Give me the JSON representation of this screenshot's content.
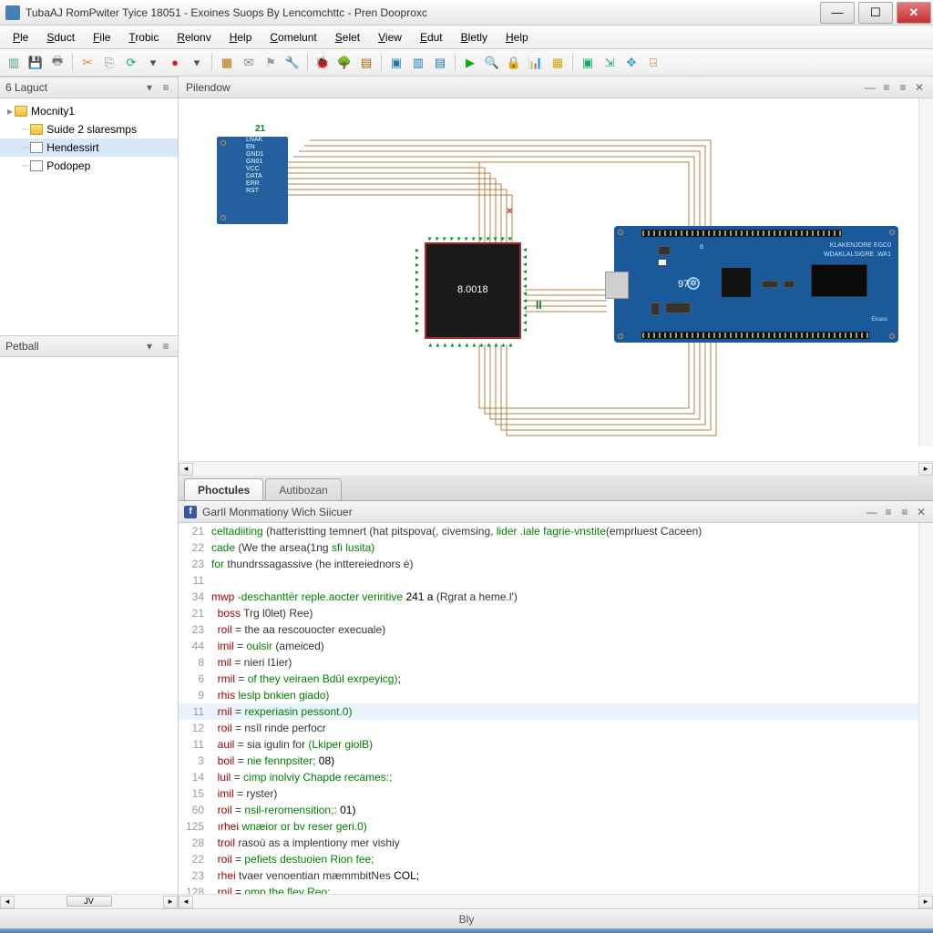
{
  "titlebar": {
    "text": "TubaAJ RomPwiter Tyice 18051 - Exoines Suops By Lencomchttc - Pren Dooproxc"
  },
  "menubar": [
    "Ple",
    "Sduct",
    "File",
    "Trobic",
    "Relonv",
    "Help",
    "Comelunt",
    "Selet",
    "View",
    "Edut",
    "Bletly",
    "Help"
  ],
  "left": {
    "layout_title": "6 Laguct",
    "tree": {
      "root": "Mocnity1",
      "children": [
        "Suide 2 slaresmps",
        "Hendessirt",
        "Podopep"
      ]
    },
    "lower_title": "Petball",
    "bottom_tab": "JV"
  },
  "canvas": {
    "title": "Pilendow",
    "net_label": "21",
    "chip_label": "8.0018",
    "pause_label": "II",
    "arduino_num": "97",
    "arduino_title1": "KLAKENJORE EGC0",
    "arduino_title2": "WDAKLALSIGRE .WA1",
    "module_pins": [
      "LNAK",
      "EN",
      "GND1",
      "GN01",
      "VCC",
      "DATA",
      "ERR",
      "RST"
    ]
  },
  "bottom_tabs": {
    "active": "Phoctules",
    "inactive": "Autibozan"
  },
  "code": {
    "title": "GarIl Monmationy Wich Siicuer",
    "status": "Bly",
    "lines": [
      {
        "n": "21",
        "html": "<span class='kw-green'>celtadiiting</span> <span class='kw-dark'>(hatteristting temnert (hat pitspova(, civemsing,</span> <span class='kw-green'>lider .iale fagrie-vnstite</span><span class='kw-dark'>(emprluest Caceen)</span>"
      },
      {
        "n": "22",
        "html": "<span class='kw-green'>cade</span> <span class='kw-dark'>(We the arsea(1ng</span> <span class='kw-green'>sfi lusita)</span>"
      },
      {
        "n": "23",
        "html": "<span class='kw-green'>for</span> <span class='kw-dark'>thundrssagassive (he inttereiednors é)</span>"
      },
      {
        "n": "11",
        "html": ""
      },
      {
        "n": "34",
        "html": "<span class='kw-red'>mwp</span> <span class='kw-green'>-deschanttër reple.aocter veriritive</span> <span class='kw-black'>241 a</span> <span class='kw-dark'>(Rgrat a heme.l')</span>"
      },
      {
        "n": "21",
        "html": "  <span class='kw-red'>boss</span> <span class='kw-dark'>Trg l0let) Ree)</span>"
      },
      {
        "n": "23",
        "html": "  <span class='kw-red'>roil</span> <span class='kw-dark'>= the aa rescouocter execuale)</span>"
      },
      {
        "n": "44",
        "html": "  <span class='kw-red'>imil</span> <span class='kw-dark'>=</span> <span class='kw-green'>oulsir</span> <span class='kw-dark'>(ameiced)</span>"
      },
      {
        "n": "8",
        "html": "  <span class='kw-red'>mil</span> <span class='kw-dark'>= nieri l1ier)</span>"
      },
      {
        "n": "6",
        "html": "  <span class='kw-red'>rmil</span> <span class='kw-dark'>=</span> <span class='kw-green'>of they veiraen Bdûl exrpeyicg)</span><span class='kw-black'>;</span>"
      },
      {
        "n": "9",
        "html": "  <span class='kw-red'>rhis</span> <span class='kw-green'>leslp bnkien giado)</span>"
      },
      {
        "n": "11",
        "hl": true,
        "html": "  <span class='kw-red'>rnil</span> <span class='kw-dark'>=</span> <span class='kw-green'>rexperiasin pessont.0)</span>"
      },
      {
        "n": "12",
        "html": "  <span class='kw-red'>roil</span> <span class='kw-dark'>= nsîl rinde perfocr</span>"
      },
      {
        "n": "11",
        "html": "  <span class='kw-red'>auil</span> <span class='kw-dark'>= sia igulin for</span> <span class='kw-green'>(Lkiper giolB)</span>"
      },
      {
        "n": "3",
        "html": "  <span class='kw-red'>boil</span> <span class='kw-dark'>=</span> <span class='kw-green'>nie fennpsiter;</span> <span class='kw-black'>08)</span>"
      },
      {
        "n": "14",
        "html": "  <span class='kw-red'>luil</span> <span class='kw-dark'>=</span> <span class='kw-green'>cimp inolviy Chapde recames:;</span>"
      },
      {
        "n": "15",
        "html": "  <span class='kw-red'>imil</span> <span class='kw-dark'>= ryster)</span>"
      },
      {
        "n": "60",
        "html": "  <span class='kw-red'>roil</span> <span class='kw-dark'>=</span> <span class='kw-green'>nsil-reromensition;:</span> <span class='kw-black'>01)</span>"
      },
      {
        "n": "125",
        "html": "  <span class='kw-red'>ırhei</span> <span class='kw-green'>wnæior or bv reser geri.0)</span>"
      },
      {
        "n": "28",
        "html": "  <span class='kw-red'>troil</span> <span class='kw-dark'>rasoù as a implentiony mer vishiy</span>"
      },
      {
        "n": "22",
        "html": "  <span class='kw-red'>roil</span> <span class='kw-dark'>=</span> <span class='kw-green'>pefiets destuoien Rion fee;</span>"
      },
      {
        "n": "23",
        "html": "  <span class='kw-red'>rhei</span> <span class='kw-dark'>tvaer venoentian mæmmbitNes</span> <span class='kw-black'>COL;</span>"
      },
      {
        "n": "128",
        "html": "  <span class='kw-red'>rnil</span> <span class='kw-dark'>=</span> <span class='kw-green'>omp the fley Reo;</span>"
      }
    ]
  }
}
